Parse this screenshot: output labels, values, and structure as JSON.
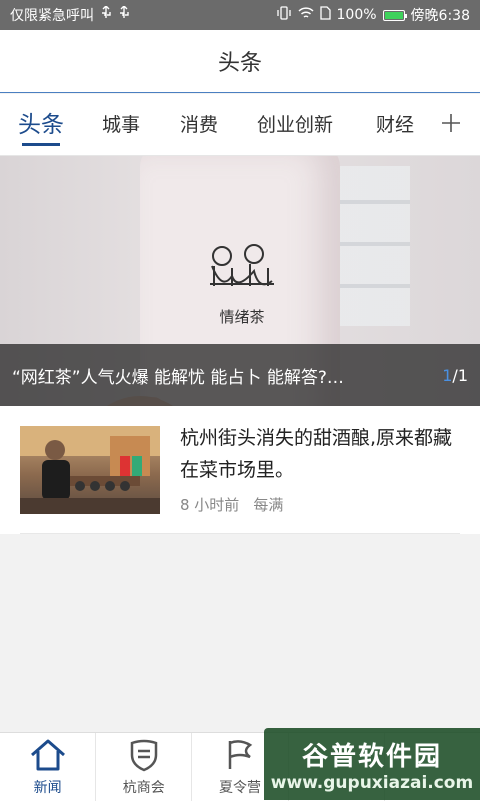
{
  "status_bar": {
    "left_text": "仅限紧急呼叫",
    "usb_icons": [
      "usb-icon",
      "usb-icon"
    ],
    "battery_percent": "100%",
    "time": "傍晚6:38"
  },
  "title_bar": {
    "title": "头条"
  },
  "tabs": {
    "items": [
      "头条",
      "城事",
      "消费",
      "创业创新",
      "财经"
    ],
    "active_index": 0,
    "add_icon": "plus-icon"
  },
  "banner": {
    "caption": "“网红茶”人气火爆 能解忧 能占卜 能解答?…",
    "pager_current": "1",
    "pager_total": "/1",
    "logo_text": "情绪茶"
  },
  "news": [
    {
      "title": "杭州街头消失的甜酒酿,原来都藏在菜市场里。",
      "time": "8 小时前",
      "source": "每满"
    }
  ],
  "bottom_nav": {
    "items": [
      {
        "label": "新闻",
        "icon": "home-icon",
        "active": true
      },
      {
        "label": "杭商会",
        "icon": "shield-icon",
        "active": false
      },
      {
        "label": "夏令营",
        "icon": "flag-icon",
        "active": false
      }
    ]
  },
  "watermark": {
    "line1": "谷普软件园",
    "line2": "www.gupuxiazai.com"
  },
  "colors": {
    "accent": "#1c4b8c",
    "status_bar": "#6b6b6b",
    "battery": "#3fd25c"
  }
}
